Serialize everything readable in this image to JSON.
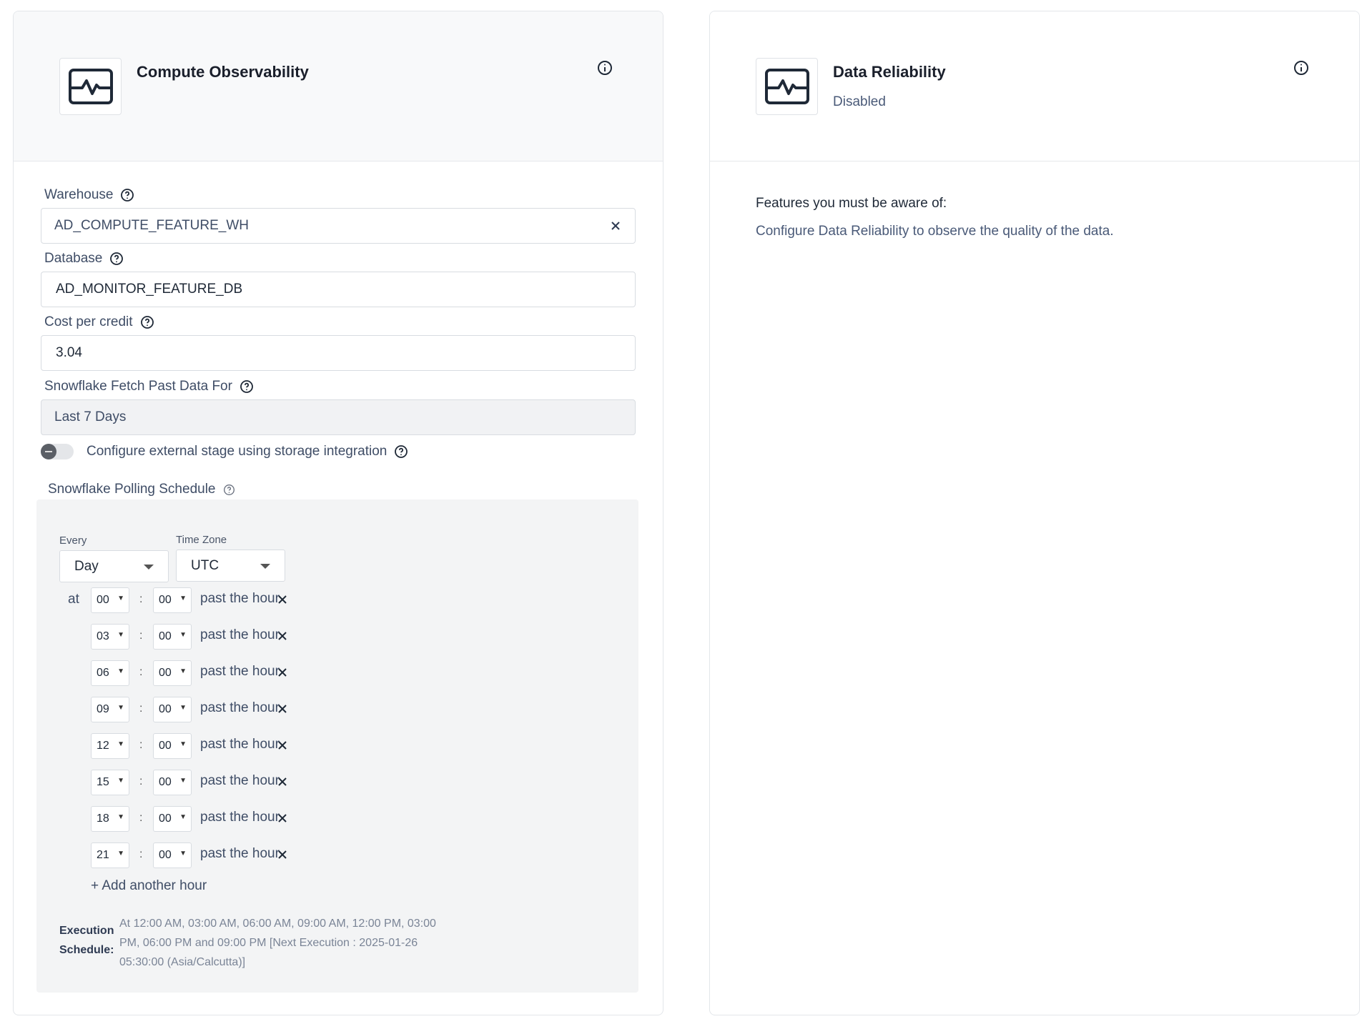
{
  "compute_card": {
    "title": "Compute Observability",
    "icon": "activity-monitor-icon",
    "fields": {
      "warehouse": {
        "label": "Warehouse",
        "value": "AD_COMPUTE_FEATURE_WH"
      },
      "database": {
        "label": "Database",
        "value": "AD_MONITOR_FEATURE_DB"
      },
      "cost": {
        "label": "Cost per credit",
        "value": "3.04"
      },
      "fetch": {
        "label": "Snowflake Fetch Past Data For",
        "value": "Last 7 Days"
      }
    },
    "toggle_label": "Configure external stage using storage integration",
    "toggle_on": false,
    "schedule": {
      "title": "Snowflake Polling Schedule",
      "every_label": "Every",
      "every_value": "Day",
      "timezone_label": "Time Zone",
      "timezone_value": "UTC",
      "at_label": "at",
      "colon": ":",
      "past_label": "past the hour",
      "hours": [
        {
          "hour": "00",
          "minute": "00"
        },
        {
          "hour": "03",
          "minute": "00"
        },
        {
          "hour": "06",
          "minute": "00"
        },
        {
          "hour": "09",
          "minute": "00"
        },
        {
          "hour": "12",
          "minute": "00"
        },
        {
          "hour": "15",
          "minute": "00"
        },
        {
          "hour": "18",
          "minute": "00"
        },
        {
          "hour": "21",
          "minute": "00"
        }
      ],
      "add_hour_label": "+ Add another hour",
      "execution_label": "Execution Schedule:",
      "execution_text": "At 12:00 AM, 03:00 AM, 06:00 AM, 09:00 AM, 12:00 PM, 03:00 PM, 06:00 PM and 09:00 PM [Next Execution : 2025-01-26 05:30:00 (Asia/Calcutta)]"
    }
  },
  "reliability_card": {
    "title": "Data Reliability",
    "subtitle": "Disabled",
    "icon": "activity-monitor-icon",
    "aware_label": "Features you must be aware of:",
    "aware_text": "Configure Data Reliability to observe the quality of the data."
  },
  "colors": {
    "header_bg": "#f8f9fa",
    "panel_bg": "#f3f4f5",
    "muted_text": "#3f4d66",
    "border": "#d8dce1"
  }
}
